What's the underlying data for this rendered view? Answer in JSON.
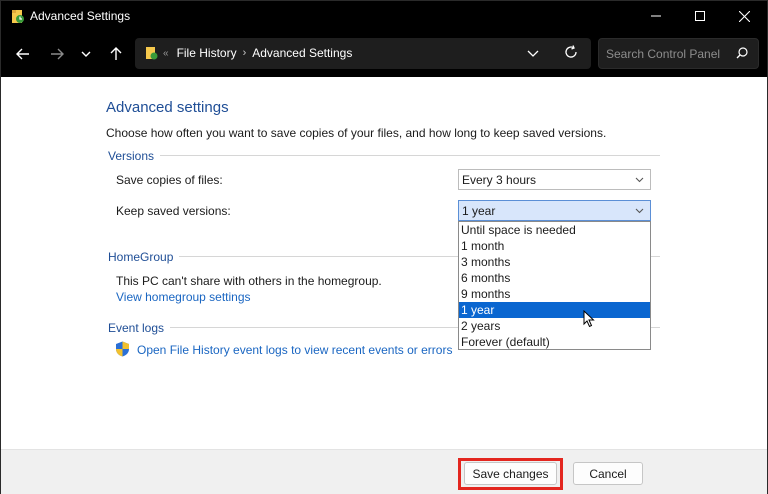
{
  "window": {
    "title": "Advanced Settings",
    "icons": [
      "file-history-icon",
      "minimize-icon",
      "maximize-icon",
      "close-icon"
    ]
  },
  "navbar": {
    "breadcrumb_overflow": "«",
    "breadcrumbs": [
      "File History",
      "Advanced Settings"
    ],
    "breadcrumb_separator": "›",
    "search_placeholder": "Search Control Panel",
    "icons": [
      "back-arrow-icon",
      "forward-arrow-icon",
      "recent-locations-chevron-icon",
      "up-arrow-icon",
      "folder-icon",
      "address-dropdown-chevron-icon",
      "refresh-icon",
      "search-icon"
    ]
  },
  "page": {
    "heading": "Advanced settings",
    "description": "Choose how often you want to save copies of your files, and how long to keep saved versions."
  },
  "versions": {
    "label": "Versions",
    "save_copies_label": "Save copies of files:",
    "save_copies_value": "Every 3 hours",
    "keep_versions_label": "Keep saved versions:",
    "keep_versions_value": "1 year",
    "keep_versions_options": [
      "Until space is needed",
      "1 month",
      "3 months",
      "6 months",
      "9 months",
      "1 year",
      "2 years",
      "Forever (default)"
    ],
    "selected_option_index": 5
  },
  "homegroup": {
    "label": "HomeGroup",
    "message": "This PC can't share with others in the homegroup.",
    "link": "View homegroup settings"
  },
  "event_logs": {
    "label": "Event logs",
    "link": "Open File History event logs to view recent events or errors",
    "icon": "uac-shield-icon"
  },
  "footer": {
    "save_label": "Save changes",
    "cancel_label": "Cancel",
    "highlight_color": "#e3261f"
  },
  "colors": {
    "heading": "#1f4e96",
    "link": "#1a66c2",
    "selection": "#0a66d0",
    "titlebar": "#000000"
  }
}
